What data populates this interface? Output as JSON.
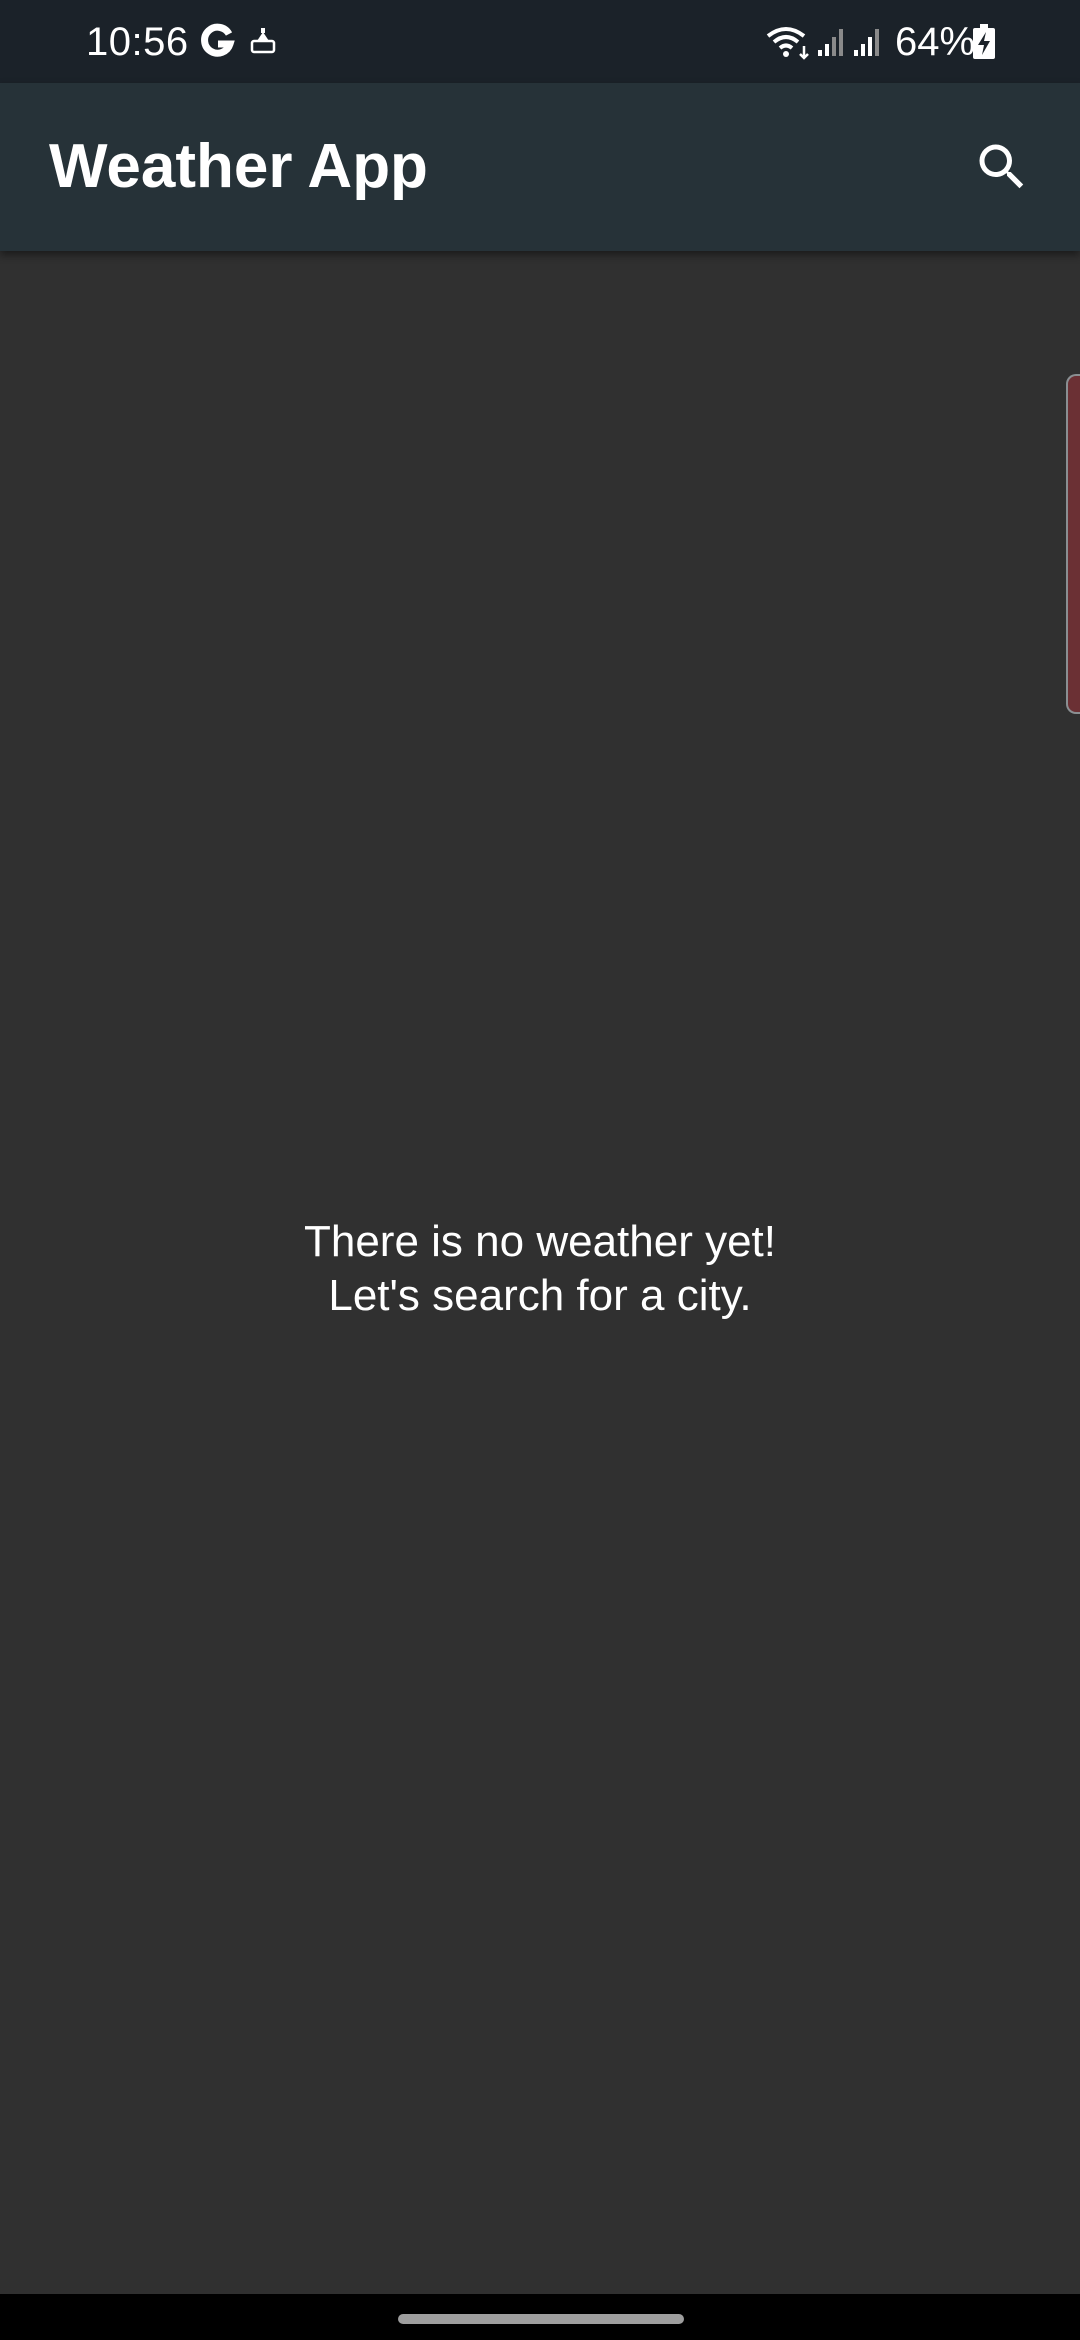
{
  "status_bar": {
    "time": "10:56",
    "battery_percent": "64%",
    "icons": [
      "google-g-icon",
      "notification-icon",
      "wifi-icon",
      "signal-icon",
      "signal-icon",
      "battery-charging-icon"
    ]
  },
  "app_bar": {
    "title": "Weather App",
    "search_icon": "search-icon"
  },
  "main": {
    "empty_line_1": "There is no weather yet!",
    "empty_line_2": "Let's search for a city."
  },
  "colors": {
    "status_bar_bg": "#1b2229",
    "app_bar_bg": "#263238",
    "background": "#303030",
    "text": "#ffffff",
    "edge_handle": "#6b3034"
  }
}
